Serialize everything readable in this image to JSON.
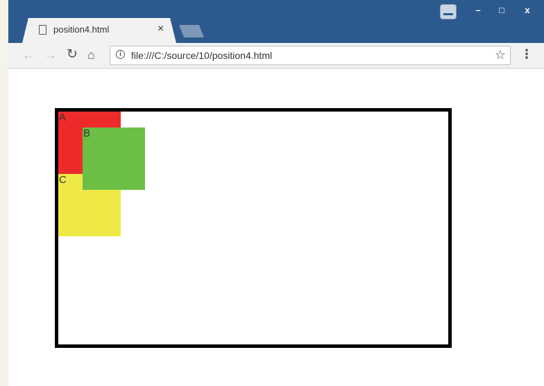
{
  "browser": {
    "tab_title": "position4.html",
    "tab_close": "×",
    "url": "file:///C:/source/10/position4.html",
    "window_controls": {
      "minimize": "–",
      "maximize": "□",
      "close": "x"
    },
    "icons": {
      "back": "back-arrow-icon",
      "forward": "forward-arrow-icon",
      "reload": "reload-icon",
      "home": "home-icon",
      "info": "info-icon",
      "star": "star-icon",
      "menu": "menu-icon",
      "page": "page-icon"
    }
  },
  "page": {
    "boxes": [
      {
        "label": "A",
        "color": "#ee2a2b"
      },
      {
        "label": "B",
        "color": "#6cbf45"
      },
      {
        "label": "C",
        "color": "#efe947"
      }
    ],
    "container_border_color": "#000000"
  }
}
